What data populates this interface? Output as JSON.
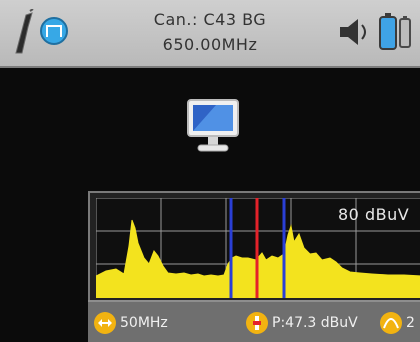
{
  "header": {
    "channel_label": "Can.: C43 BG",
    "frequency": "650.00MHz",
    "left_icons": [
      "probe-icon",
      "signal-mode-icon"
    ],
    "right_icons": [
      "speaker-icon",
      "battery-icon"
    ]
  },
  "main": {
    "icon": "monitor-icon"
  },
  "spectrum": {
    "reference_level": "80 dBuV",
    "trace_color": "#f3e31e",
    "marker_color": "#e4222a",
    "channel_bound_color": "#2a3fd6"
  },
  "footer": {
    "span": "50MHz",
    "power": "P:47.3 dBuV",
    "extra": "2"
  }
}
